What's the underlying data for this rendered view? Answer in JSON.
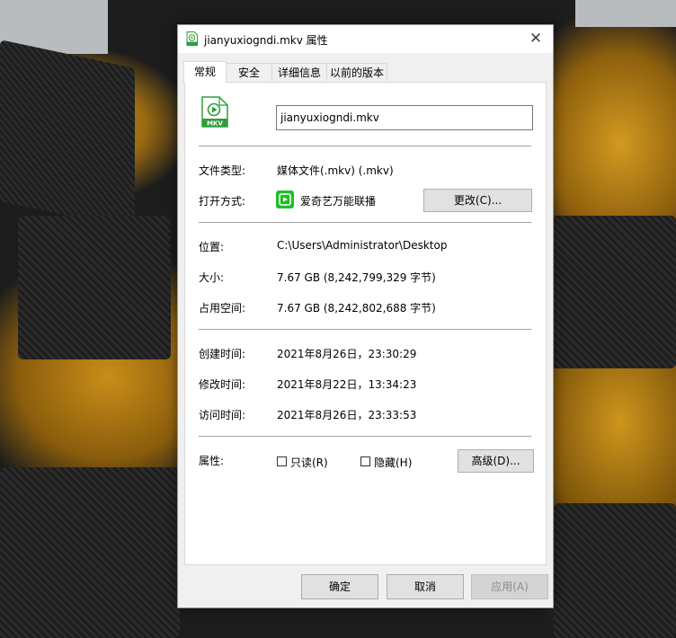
{
  "window": {
    "title": "jianyuxiogndi.mkv 属性",
    "close_glyph": "✕"
  },
  "tabs": [
    {
      "label": "常规",
      "active": true
    },
    {
      "label": "安全",
      "active": false
    },
    {
      "label": "详细信息",
      "active": false
    },
    {
      "label": "以前的版本",
      "active": false
    }
  ],
  "general": {
    "file_icon_text": "MKV",
    "file_name": "jianyuxiogndi.mkv",
    "file_type_label": "文件类型:",
    "file_type_value": "媒体文件(.mkv) (.mkv)",
    "open_with_label": "打开方式:",
    "open_with_value": "爱奇艺万能联播",
    "change_button": "更改(C)...",
    "location_label": "位置:",
    "location_value": "C:\\Users\\Administrator\\Desktop",
    "size_label": "大小:",
    "size_value": "7.67 GB (8,242,799,329 字节)",
    "disk_size_label": "占用空间:",
    "disk_size_value": "7.67 GB (8,242,802,688 字节)",
    "created_label": "创建时间:",
    "created_value": "2021年8月26日，23:30:29",
    "modified_label": "修改时间:",
    "modified_value": "2021年8月22日，13:34:23",
    "accessed_label": "访问时间:",
    "accessed_value": "2021年8月26日，23:33:53",
    "attributes_label": "属性:",
    "readonly_label": "只读(R)",
    "readonly_checked": false,
    "hidden_label": "隐藏(H)",
    "hidden_checked": false,
    "advanced_button": "高级(D)..."
  },
  "footer": {
    "ok": "确定",
    "cancel": "取消",
    "apply": "应用(A)"
  },
  "colors": {
    "dialog_bg": "#f0f0f0",
    "panel_bg": "#ffffff",
    "button_bg": "#e1e1e1",
    "mkv_icon_green": "#2e9e3a",
    "app_icon_green": "#1fbf2a"
  }
}
